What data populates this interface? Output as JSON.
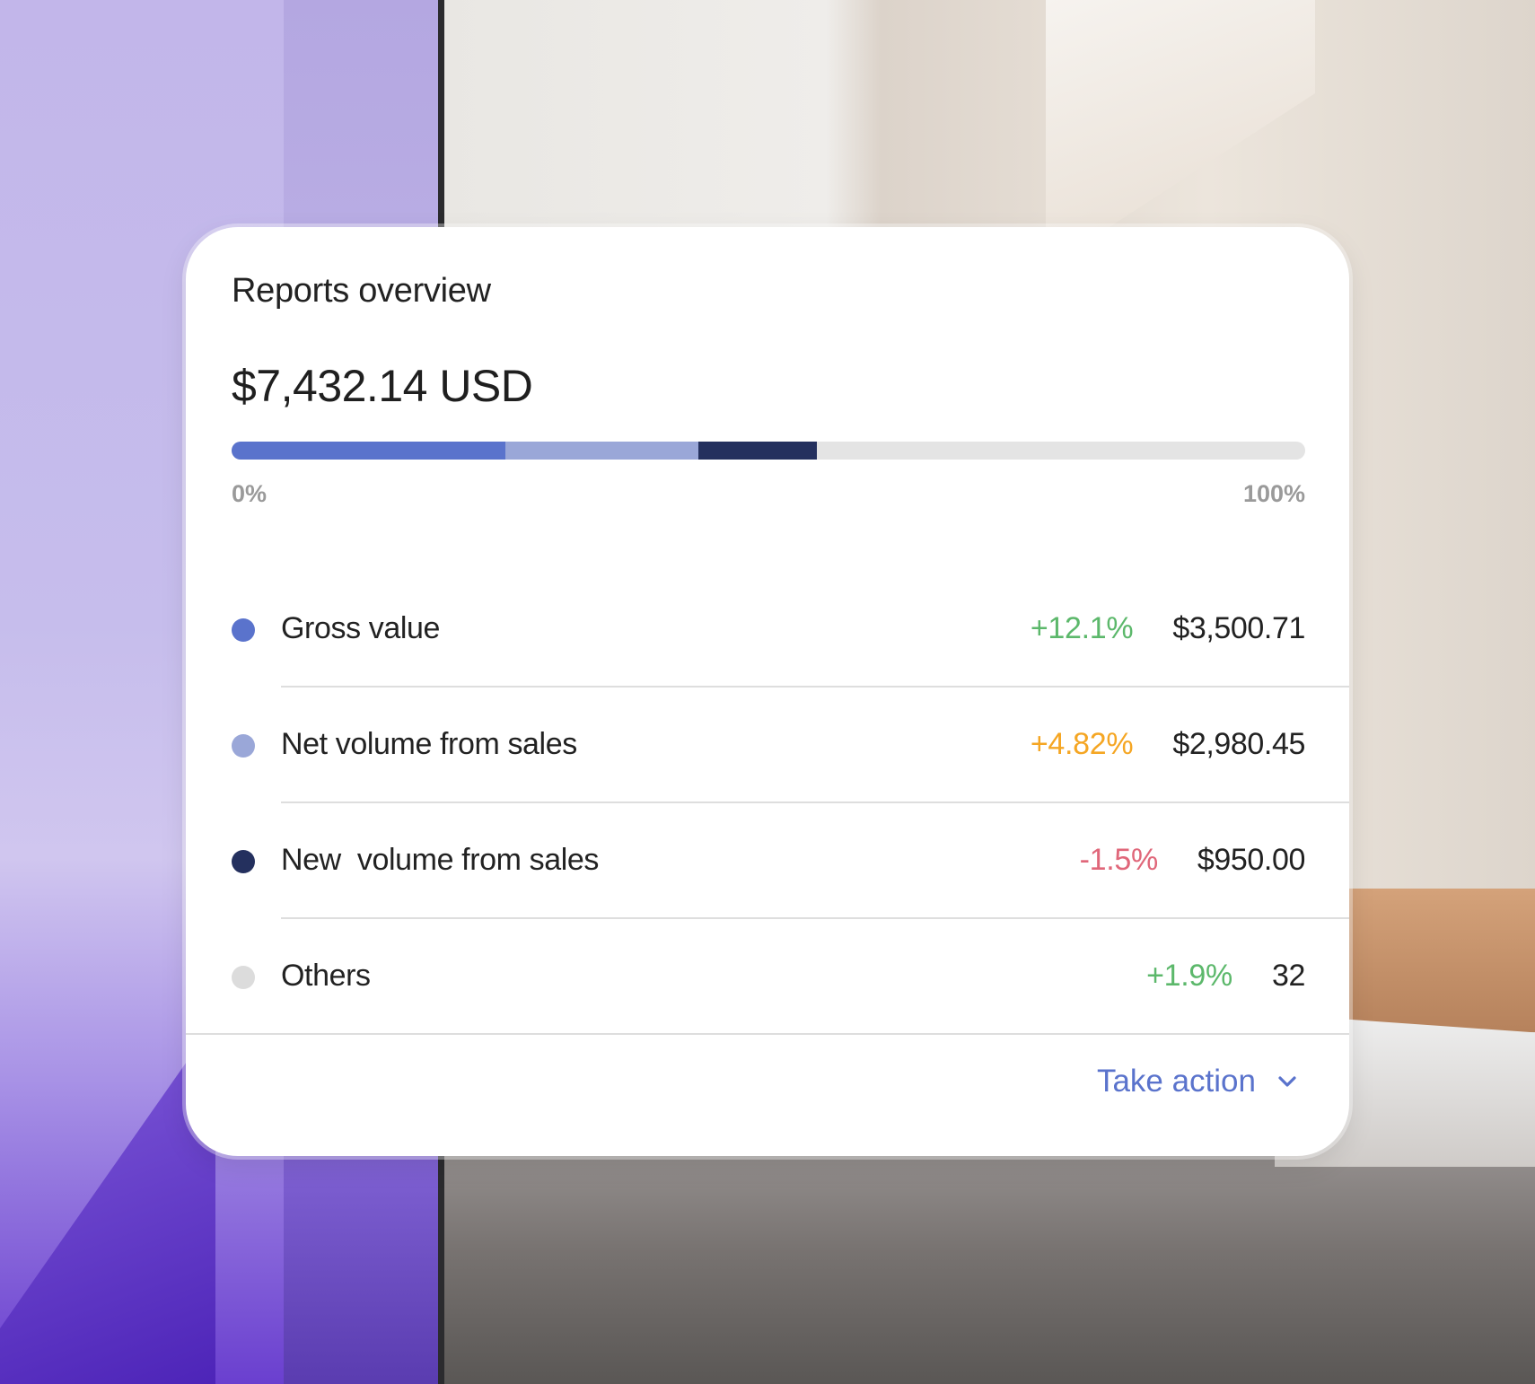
{
  "card": {
    "title": "Reports overview",
    "total": "$7,432.14 USD",
    "progress": {
      "segments": [
        {
          "name": "Gross value",
          "fraction": 0.255,
          "color": "#5a73cc"
        },
        {
          "name": "Net volume from sales",
          "fraction": 0.18,
          "color": "#9aa7d8"
        },
        {
          "name": "New  volume from sales",
          "fraction": 0.11,
          "color": "#24305e"
        }
      ],
      "track_color": "#e4e4e4",
      "min_label": "0%",
      "max_label": "100%"
    },
    "rows": [
      {
        "label": "Gross value",
        "change": "+12.1%",
        "amount": "$3,500.71",
        "dot_color": "#5a73cc",
        "change_color": "#5cb86b"
      },
      {
        "label": "Net volume from sales",
        "change": "+4.82%",
        "amount": "$2,980.45",
        "dot_color": "#9aa7d8",
        "change_color": "#f5a623"
      },
      {
        "label": "New  volume from sales",
        "change": "-1.5%",
        "amount": "$950.00",
        "dot_color": "#24305e",
        "change_color": "#e0677a"
      },
      {
        "label": "Others",
        "change": "+1.9%",
        "amount": "32",
        "dot_color": "#dcdcdc",
        "change_color": "#5cb86b"
      }
    ],
    "action": {
      "label": "Take action",
      "icon": "chevron-down-icon",
      "color": "#5a73cc"
    }
  }
}
